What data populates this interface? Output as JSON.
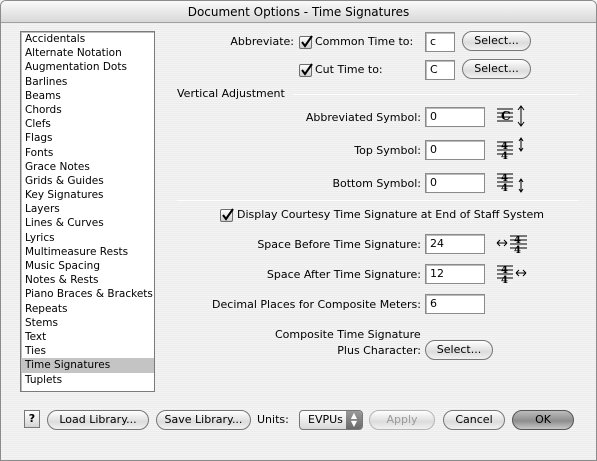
{
  "window": {
    "title": "Document Options - Time Signatures"
  },
  "sidebar": {
    "items": [
      {
        "label": "Accidentals"
      },
      {
        "label": "Alternate Notation"
      },
      {
        "label": "Augmentation Dots"
      },
      {
        "label": "Barlines"
      },
      {
        "label": "Beams"
      },
      {
        "label": "Chords"
      },
      {
        "label": "Clefs"
      },
      {
        "label": "Flags"
      },
      {
        "label": "Fonts"
      },
      {
        "label": "Grace Notes"
      },
      {
        "label": "Grids & Guides"
      },
      {
        "label": "Key Signatures"
      },
      {
        "label": "Layers"
      },
      {
        "label": "Lines & Curves"
      },
      {
        "label": "Lyrics"
      },
      {
        "label": "Multimeasure Rests"
      },
      {
        "label": "Music Spacing"
      },
      {
        "label": "Notes & Rests"
      },
      {
        "label": "Piano Braces & Brackets"
      },
      {
        "label": "Repeats"
      },
      {
        "label": "Stems"
      },
      {
        "label": "Text"
      },
      {
        "label": "Ties"
      },
      {
        "label": "Time Signatures",
        "selected": true
      },
      {
        "label": "Tuplets"
      }
    ]
  },
  "abbreviate": {
    "label": "Abbreviate:",
    "common_time": {
      "label": "Common Time to:",
      "checked": true,
      "value": "c",
      "button": "Select..."
    },
    "cut_time": {
      "label": "Cut Time to:",
      "checked": true,
      "value": "C",
      "button": "Select..."
    }
  },
  "vertical": {
    "title": "Vertical Adjustment",
    "abbreviated_symbol": {
      "label": "Abbreviated Symbol:",
      "value": "0",
      "icon": "abbreviated-symbol-vertical-icon"
    },
    "top_symbol": {
      "label": "Top Symbol:",
      "value": "0",
      "icon": "top-symbol-vertical-icon"
    },
    "bottom_symbol": {
      "label": "Bottom Symbol:",
      "value": "0",
      "icon": "bottom-symbol-vertical-icon"
    }
  },
  "courtesy": {
    "label": "Display Courtesy Time Signature at End of Staff System",
    "checked": true
  },
  "space_before": {
    "label": "Space Before Time Signature:",
    "value": "24",
    "icon": "space-before-icon"
  },
  "space_after": {
    "label": "Space After Time Signature:",
    "value": "12",
    "icon": "space-after-icon"
  },
  "decimal_places": {
    "label": "Decimal Places for Composite Meters:",
    "value": "6"
  },
  "composite_plus": {
    "label_line1": "Composite Time Signature",
    "label_line2": "Plus Character:",
    "button": "Select..."
  },
  "footer": {
    "help": "?",
    "load_library": "Load Library...",
    "save_library": "Save Library...",
    "units_label": "Units:",
    "units_value": "EVPUs",
    "apply": "Apply",
    "cancel": "Cancel",
    "ok": "OK"
  },
  "colors": {
    "selection": "#c4c4c4",
    "default_button": "#8e8e8e"
  }
}
